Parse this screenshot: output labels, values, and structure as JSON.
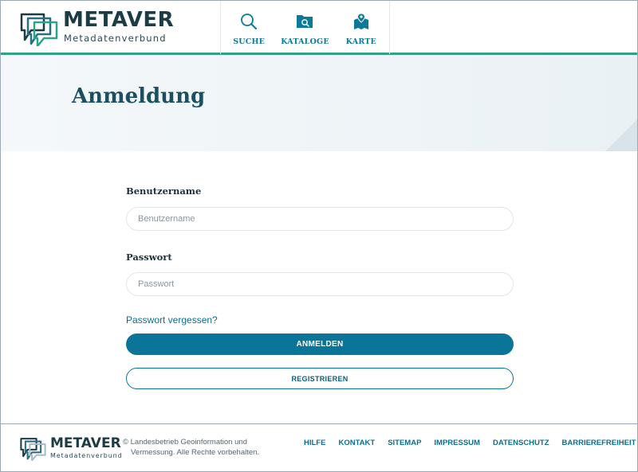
{
  "brand": {
    "name": "METAVER",
    "tagline": "Metadatenverbund"
  },
  "nav": {
    "items": [
      {
        "label": "SUCHE",
        "icon": "search-icon"
      },
      {
        "label": "KATALOGE",
        "icon": "catalog-folder-icon"
      },
      {
        "label": "KARTE",
        "icon": "map-icon"
      }
    ]
  },
  "page": {
    "title": "Anmeldung"
  },
  "form": {
    "username_label": "Benutzername",
    "username_placeholder": "Benutzername",
    "username_value": "",
    "password_label": "Passwort",
    "password_placeholder": "Passwort",
    "password_value": "",
    "forgot_link": "Passwort vergessen?",
    "login_button": "ANMELDEN",
    "register_button": "REGISTRIEREN"
  },
  "footer": {
    "brand_name": "METAVER",
    "brand_tagline": "Metadatenverbund",
    "copyright_line1": "© Landesbetrieb Geoinformation und",
    "copyright_line2": "Vermessung. Alle Rechte vorbehalten.",
    "links": [
      "HILFE",
      "KONTAKT",
      "SITEMAP",
      "IMPRESSUM",
      "DATENSCHUTZ",
      "BARRIEREFREIHEIT"
    ]
  },
  "colors": {
    "accent": "#0b7499",
    "brand_green": "#2aa58c",
    "title": "#1c4f5f"
  }
}
